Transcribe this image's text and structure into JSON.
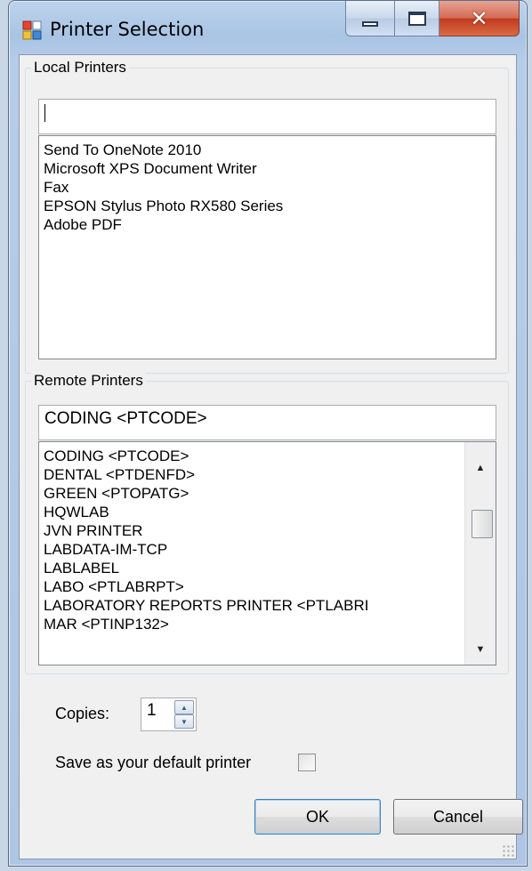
{
  "window": {
    "title": "Printer Selection"
  },
  "local_printers": {
    "group_label": "Local Printers",
    "search_value": "",
    "items": [
      "Send To OneNote 2010",
      "Microsoft XPS Document Writer",
      "Fax",
      "EPSON Stylus Photo RX580 Series",
      "Adobe PDF"
    ]
  },
  "remote_printers": {
    "group_label": "Remote Printers",
    "search_value": "CODING  <PTCODE>",
    "items": [
      "CODING  <PTCODE>",
      "DENTAL  <PTDENFD>",
      "GREEN  <PTOPATG>",
      "HQWLAB",
      "JVN PRINTER",
      "LABDATA-IM-TCP",
      "LABLABEL",
      "LABO  <PTLABRPT>",
      "LABORATORY REPORTS PRINTER  <PTLABRI",
      "MAR  <PTINP132>"
    ]
  },
  "copies": {
    "label": "Copies:",
    "value": "1"
  },
  "default_printer": {
    "label": "Save as your default printer",
    "checked": false
  },
  "buttons": {
    "ok": "OK",
    "cancel": "Cancel"
  },
  "icons": {
    "app": "printer-selection-icon",
    "min": "minimize-icon",
    "max": "maximize-icon",
    "close": "close-icon"
  }
}
